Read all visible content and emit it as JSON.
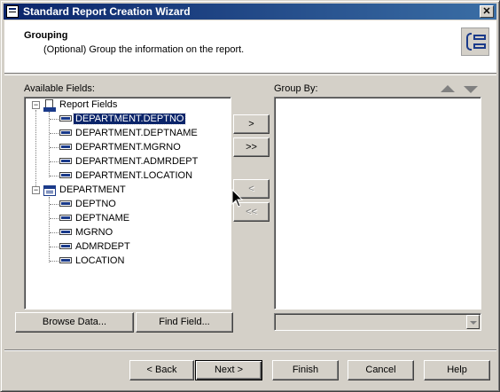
{
  "window": {
    "title": "Standard Report Creation Wizard",
    "close_label": "✕"
  },
  "header": {
    "title": "Grouping",
    "subtitle": "(Optional) Group the information on the report.",
    "icon": "grouping-icon"
  },
  "available_fields": {
    "label": "Available Fields:",
    "tree": [
      {
        "label": "Report Fields",
        "icon": "report-icon",
        "expanded": true,
        "level": 0
      },
      {
        "label": "DEPARTMENT.DEPTNO",
        "icon": "field-icon",
        "level": 1,
        "selected": true
      },
      {
        "label": "DEPARTMENT.DEPTNAME",
        "icon": "field-icon",
        "level": 1
      },
      {
        "label": "DEPARTMENT.MGRNO",
        "icon": "field-icon",
        "level": 1
      },
      {
        "label": "DEPARTMENT.ADMRDEPT",
        "icon": "field-icon",
        "level": 1
      },
      {
        "label": "DEPARTMENT.LOCATION",
        "icon": "field-icon",
        "level": 1
      },
      {
        "label": "DEPARTMENT",
        "icon": "table-icon",
        "expanded": true,
        "level": 0
      },
      {
        "label": "DEPTNO",
        "icon": "field-icon",
        "level": 1
      },
      {
        "label": "DEPTNAME",
        "icon": "field-icon",
        "level": 1
      },
      {
        "label": "MGRNO",
        "icon": "field-icon",
        "level": 1
      },
      {
        "label": "ADMRDEPT",
        "icon": "field-icon",
        "level": 1
      },
      {
        "label": "LOCATION",
        "icon": "field-icon",
        "level": 1
      }
    ],
    "browse_data": "Browse Data...",
    "find_field": "Find Field..."
  },
  "transfer": {
    "add": ">",
    "add_all": ">>",
    "remove": "<",
    "remove_all": "<<"
  },
  "group_by": {
    "label": "Group By:",
    "items": [],
    "sort_value": ""
  },
  "footer": {
    "back": "< Back",
    "next": "Next >",
    "finish": "Finish",
    "cancel": "Cancel",
    "help": "Help"
  }
}
